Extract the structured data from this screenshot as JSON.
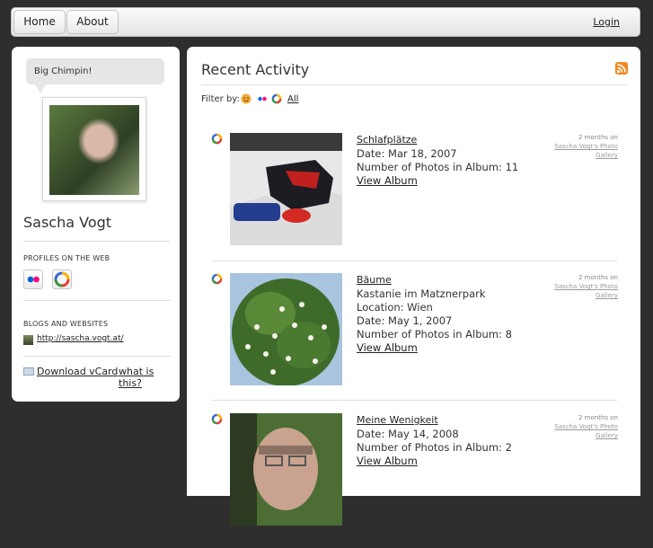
{
  "nav": {
    "home": "Home",
    "about": "About",
    "login": "Login"
  },
  "profile": {
    "status": "Big Chimpin!",
    "name": "Sascha Vogt",
    "profiles_heading": "PROFILES ON THE WEB",
    "profile_icons": [
      "flickr-icon",
      "picasa-icon"
    ],
    "blogs_heading": "BLOGS AND WEBSITES",
    "blog_url": "http://sascha.vogt.at/",
    "vcard": "Download vCard",
    "what": "what is this?"
  },
  "main": {
    "title": "Recent Activity",
    "filter_label": "Filter by:",
    "filter_all": "All",
    "items": [
      {
        "title": "Schlafplätze",
        "lines": [
          "Date: Mar 18, 2007",
          "Number of Photos in Album: 11"
        ],
        "view": "View Album",
        "time": "2 months on",
        "gallery": "Sascha Vogt's Photo Gallery"
      },
      {
        "title": "Bäume",
        "lines": [
          "Kastanie im Matznerpark",
          "Location: Wien",
          "Date: May 1, 2007",
          "Number of Photos in Album: 8"
        ],
        "view": "View Album",
        "time": "2 months on",
        "gallery": "Sascha Vogt's Photo Gallery"
      },
      {
        "title": "Meine Wenigkeit",
        "lines": [
          "Date: May 14, 2008",
          "Number of Photos in Album: 2"
        ],
        "view": "View Album",
        "time": "2 months on",
        "gallery": "Sascha Vogt's Photo Gallery"
      }
    ]
  },
  "colors": {
    "page_bg": "#2e2e2e",
    "rss": "#f08a24",
    "flickr_blue": "#0063dc",
    "flickr_pink": "#ff0084"
  }
}
